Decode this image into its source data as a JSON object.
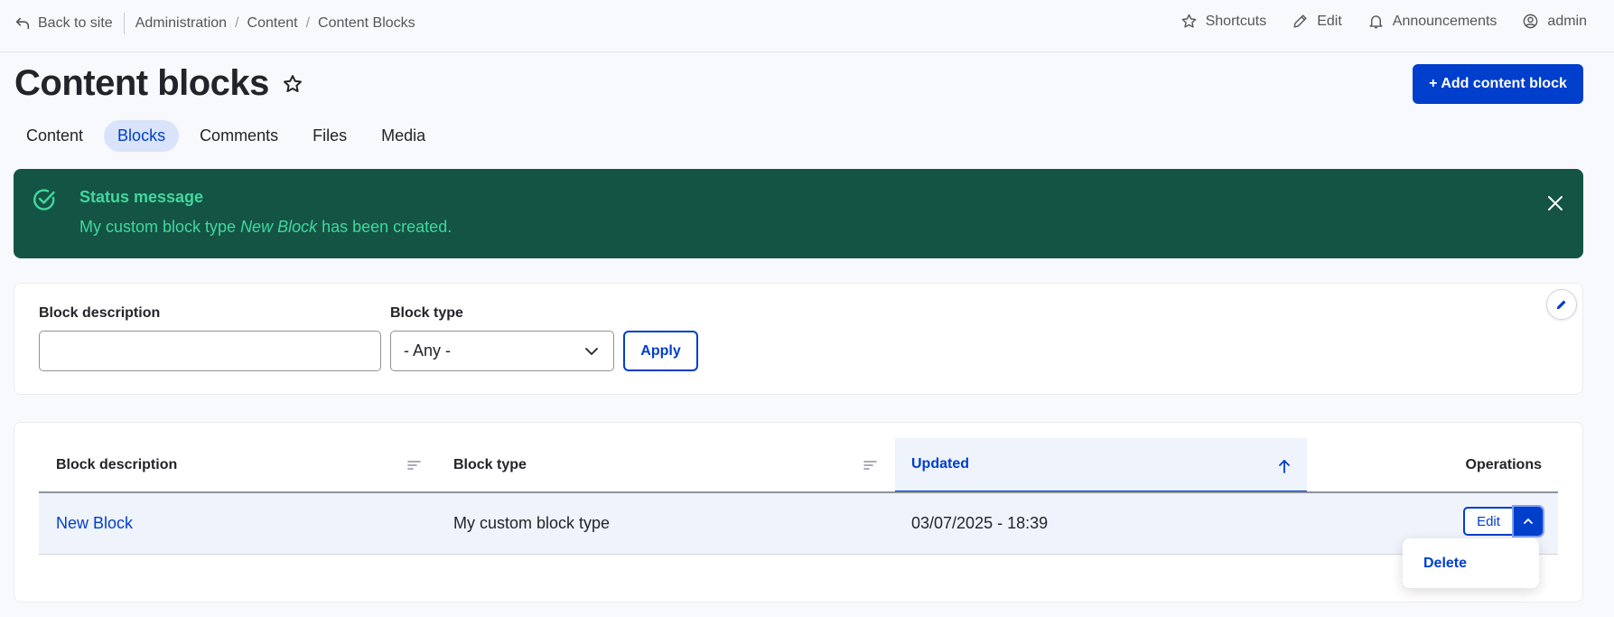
{
  "topbar": {
    "back_label": "Back to site",
    "breadcrumbs": [
      "Administration",
      "Content",
      "Content Blocks"
    ],
    "separator": "/",
    "shortcuts_label": "Shortcuts",
    "edit_label": "Edit",
    "announcements_label": "Announcements",
    "user_label": "admin"
  },
  "header": {
    "title": "Content blocks",
    "add_button_label": "+ Add content block"
  },
  "tabs": [
    {
      "label": "Content",
      "active": false
    },
    {
      "label": "Blocks",
      "active": true
    },
    {
      "label": "Comments",
      "active": false
    },
    {
      "label": "Files",
      "active": false
    },
    {
      "label": "Media",
      "active": false
    }
  ],
  "status": {
    "title": "Status message",
    "text_before": "My custom block type ",
    "text_emphasis": "New Block",
    "text_after": " has been created."
  },
  "filters": {
    "description_label": "Block description",
    "description_value": "",
    "type_label": "Block type",
    "type_selected": "- Any -",
    "apply_label": "Apply"
  },
  "table": {
    "headers": {
      "description": "Block description",
      "type": "Block type",
      "updated": "Updated",
      "operations": "Operations"
    },
    "rows": [
      {
        "description": "New Block",
        "type": "My custom block type",
        "updated": "03/07/2025 - 18:39"
      }
    ],
    "edit_label": "Edit",
    "dropdown_items": [
      "Delete"
    ]
  },
  "colors": {
    "accent": "#003ecc",
    "status_bg": "#145444",
    "status_text": "#42d79e"
  },
  "icons": [
    "back-arrow-icon",
    "star-icon",
    "pencil-icon",
    "bell-icon",
    "user-circle-icon",
    "check-circle-icon",
    "close-icon",
    "chevron-down-icon",
    "sort-lines-icon",
    "arrow-up-icon",
    "chevron-up-icon"
  ]
}
